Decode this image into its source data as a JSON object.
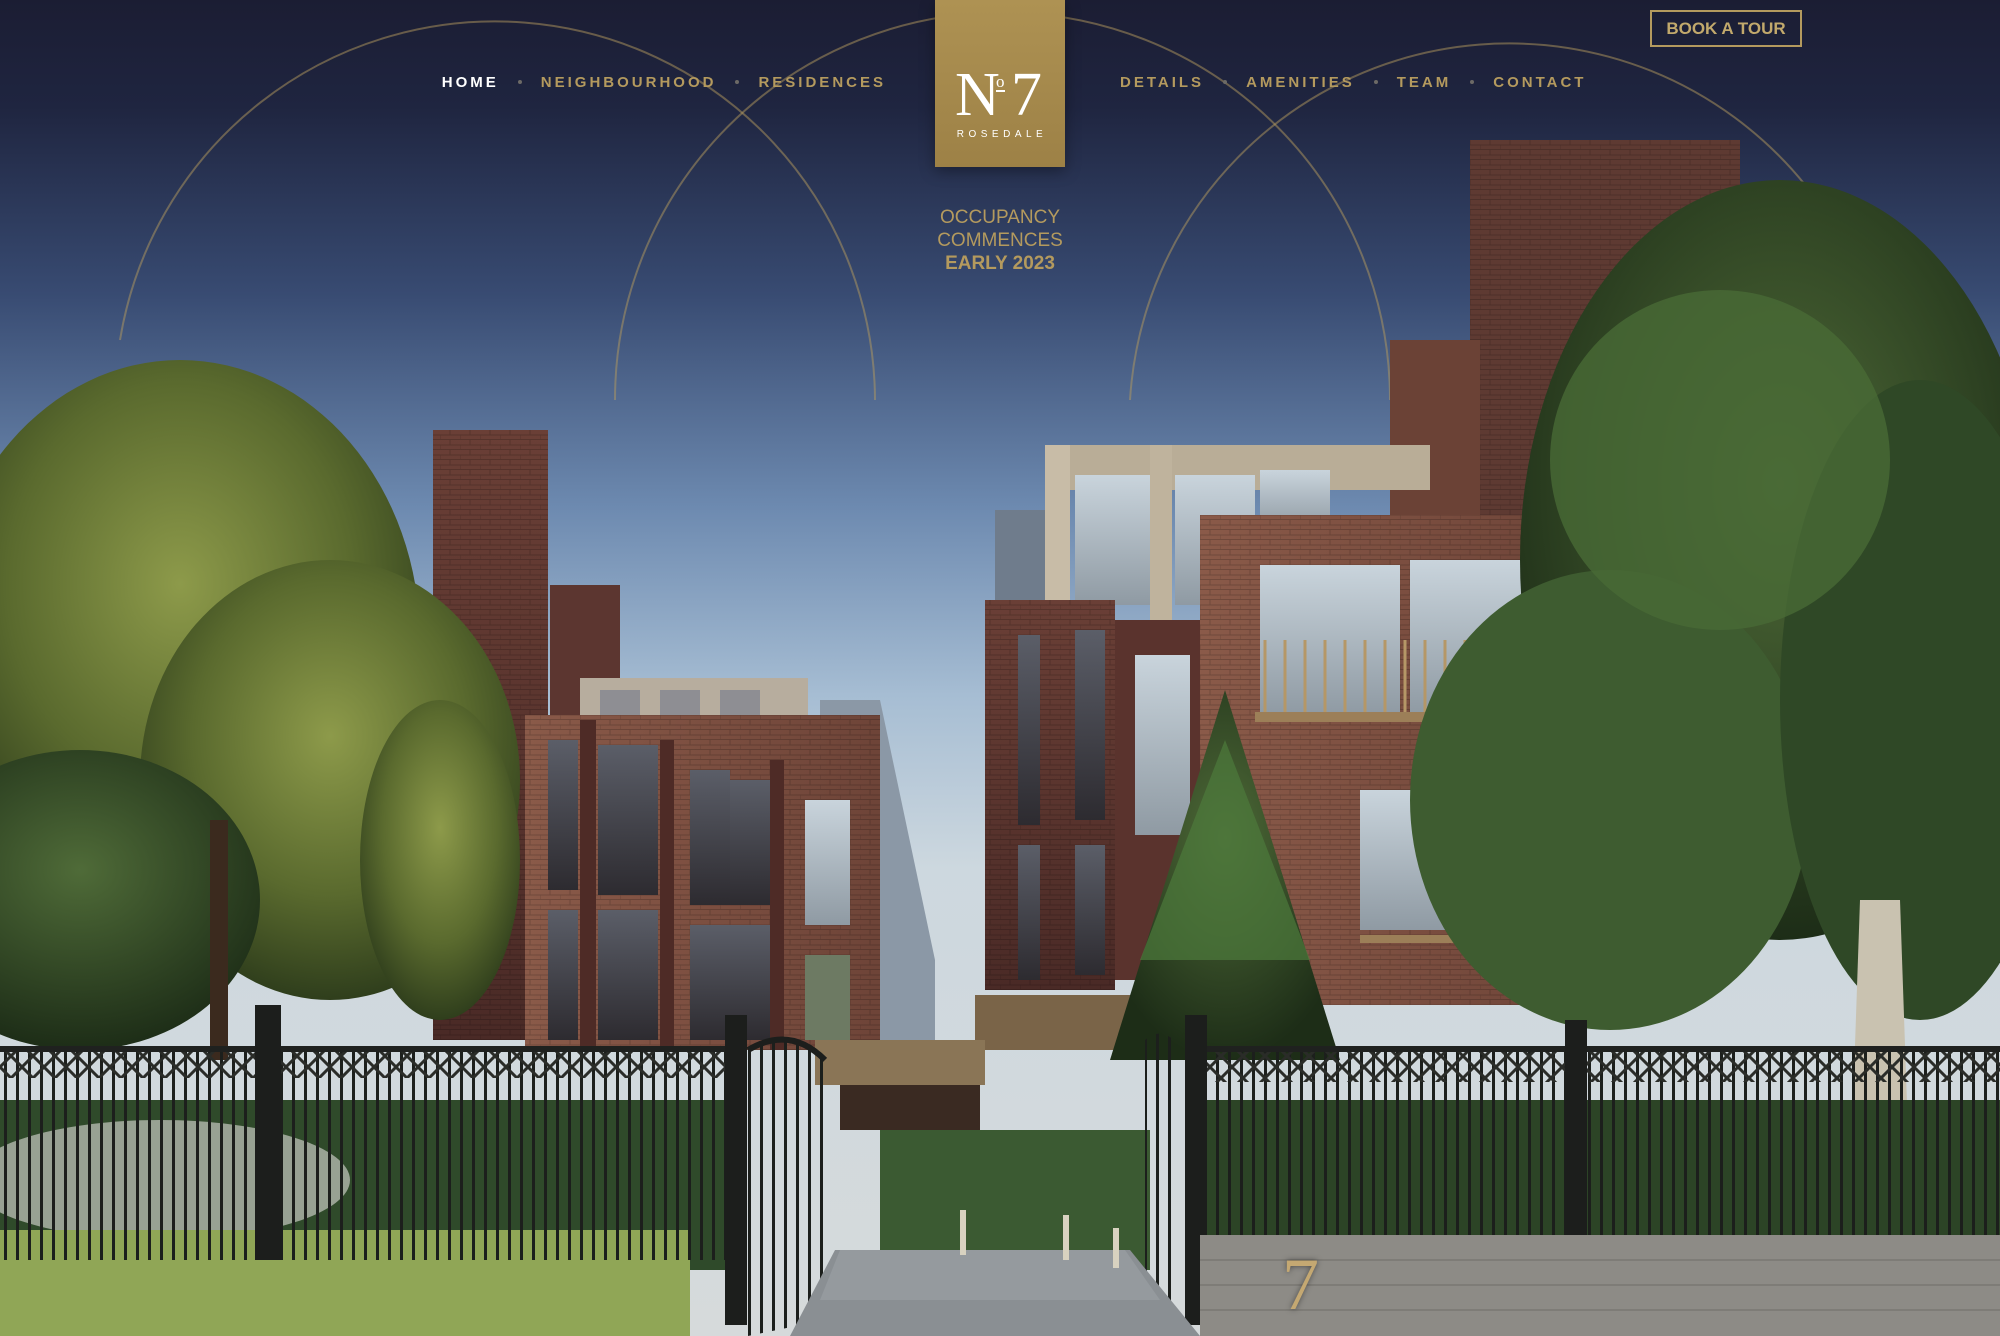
{
  "nav": {
    "left": [
      {
        "label": "HOME",
        "active": true
      },
      {
        "label": "NEIGHBOURHOOD",
        "active": false
      },
      {
        "label": "RESIDENCES",
        "active": false
      }
    ],
    "right": [
      {
        "label": "DETAILS",
        "active": false
      },
      {
        "label": "AMENITIES",
        "active": false
      },
      {
        "label": "TEAM",
        "active": false
      },
      {
        "label": "CONTACT",
        "active": false
      }
    ]
  },
  "logo": {
    "n": "N",
    "o": "o",
    "number": "7",
    "subtitle": "ROSEDALE"
  },
  "book_button": "BOOK A TOUR",
  "occupancy": {
    "line1": "OCCUPANCY",
    "line2": "COMMENCES",
    "line3": "EARLY 2023"
  },
  "address_number": "7",
  "colors": {
    "navy": "#1b1d33",
    "gold": "#b49a5e",
    "gold_badge": "#a88c4f",
    "white": "#ffffff"
  }
}
